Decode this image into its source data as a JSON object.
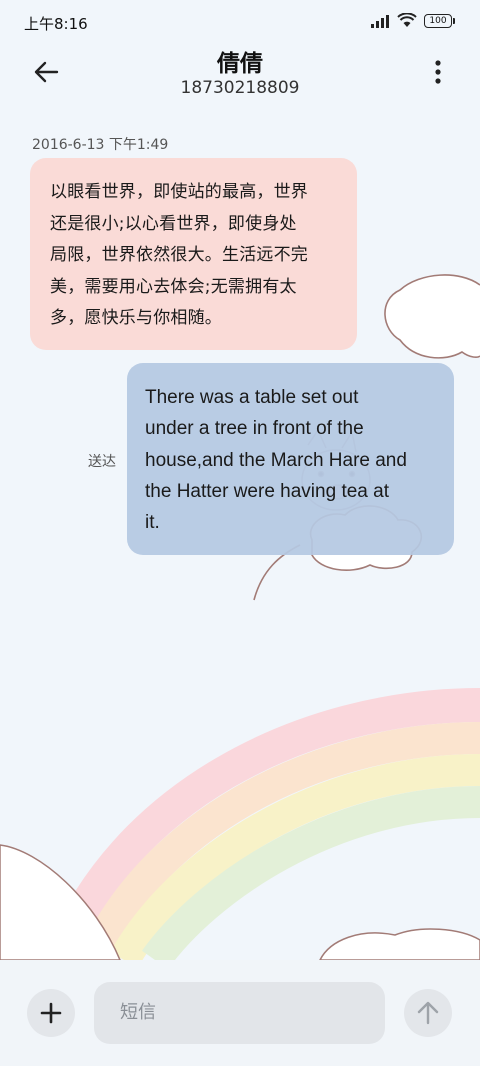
{
  "status_bar": {
    "time": "上午8:16",
    "battery": "100"
  },
  "header": {
    "contact_name": "倩倩",
    "contact_number": "18730218809"
  },
  "conversation": {
    "timestamp": "2016-6-13 下午1:49",
    "messages": [
      {
        "direction": "incoming",
        "lines": [
          "以眼看世界，即使站的最高，世界",
          "还是很小;以心看世界，即使身处",
          "局限，世界依然很大。生活远不完",
          "美，需要用心去体会;无需拥有太",
          "多，愿快乐与你相随。"
        ]
      },
      {
        "direction": "outgoing",
        "status": "送达",
        "lines": [
          "There was a table set out",
          "under a tree in front of the",
          "house,and the March Hare and",
          "the Hatter were having tea at",
          "it."
        ]
      }
    ]
  },
  "composer": {
    "placeholder": "短信"
  },
  "icons": {
    "back": "arrow-left-icon",
    "menu": "more-vertical-icon",
    "add": "plus-icon",
    "send": "arrow-up-icon"
  },
  "colors": {
    "background": "#f1f6fb",
    "incoming_bubble": "#fadad6",
    "outgoing_bubble": "#b5c8e2"
  }
}
